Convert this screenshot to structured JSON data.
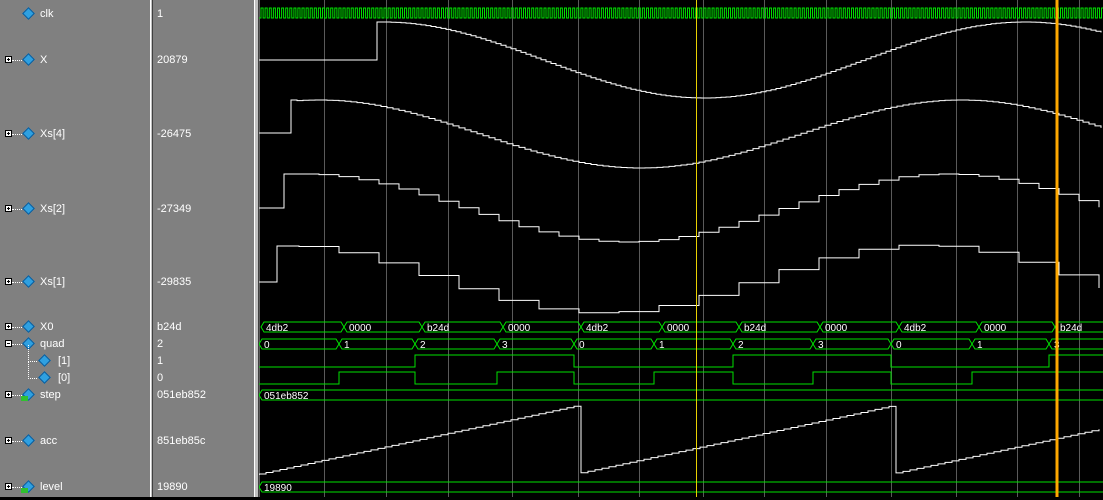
{
  "signals": [
    {
      "id": "clk",
      "name": "clk",
      "value": "1",
      "icon": "signal-diamond-icon",
      "expander": "none",
      "indent": 0
    },
    {
      "id": "x",
      "name": "X",
      "value": "20879",
      "icon": "signal-diamond-icon",
      "expander": "plus",
      "indent": 0
    },
    {
      "id": "xs4",
      "name": "Xs[4]",
      "value": "-26475",
      "icon": "signal-diamond-icon",
      "expander": "plus",
      "indent": 0
    },
    {
      "id": "xs2",
      "name": "Xs[2]",
      "value": "-27349",
      "icon": "signal-diamond-icon",
      "expander": "plus",
      "indent": 0
    },
    {
      "id": "xs1",
      "name": "Xs[1]",
      "value": "-29835",
      "icon": "signal-diamond-icon",
      "expander": "plus",
      "indent": 0
    },
    {
      "id": "x0",
      "name": "X0",
      "value": "b24d",
      "icon": "signal-diamond-icon",
      "expander": "plus",
      "indent": 0
    },
    {
      "id": "quad",
      "name": "quad",
      "value": "2",
      "icon": "signal-diamond-icon",
      "expander": "minus",
      "indent": 0
    },
    {
      "id": "quad1",
      "name": "[1]",
      "value": "1",
      "icon": "signal-diamond-icon",
      "expander": "none",
      "indent": 1
    },
    {
      "id": "quad0",
      "name": "[0]",
      "value": "0",
      "icon": "signal-diamond-icon",
      "expander": "none",
      "indent": 1
    },
    {
      "id": "step",
      "name": "step",
      "value": "051eb852",
      "icon": "input-signal-icon",
      "expander": "plus",
      "indent": 0
    },
    {
      "id": "acc",
      "name": "acc",
      "value": "851eb85c",
      "icon": "signal-diamond-icon",
      "expander": "plus",
      "indent": 0
    },
    {
      "id": "level",
      "name": "level",
      "value": "19890",
      "icon": "input-signal-icon",
      "expander": "plus",
      "indent": 0
    }
  ],
  "bus_labels": {
    "x0": [
      "4db2",
      "0000",
      "b24d",
      "0000",
      "4db2",
      "0000",
      "b24d",
      "0000",
      "4db2",
      "0000",
      "b24d"
    ],
    "quad": [
      "0",
      "1",
      "2",
      "3",
      "0",
      "1",
      "2",
      "3",
      "0",
      "1",
      "3"
    ],
    "step": [
      "051eb852"
    ],
    "level": [
      "19890"
    ]
  },
  "colors": {
    "wave": "#00e000",
    "analog": "#ffffff",
    "grid": "#5a5a5a",
    "cursor1": "#e8d000",
    "cursor2": "#ffa800",
    "panel": "#808080"
  }
}
